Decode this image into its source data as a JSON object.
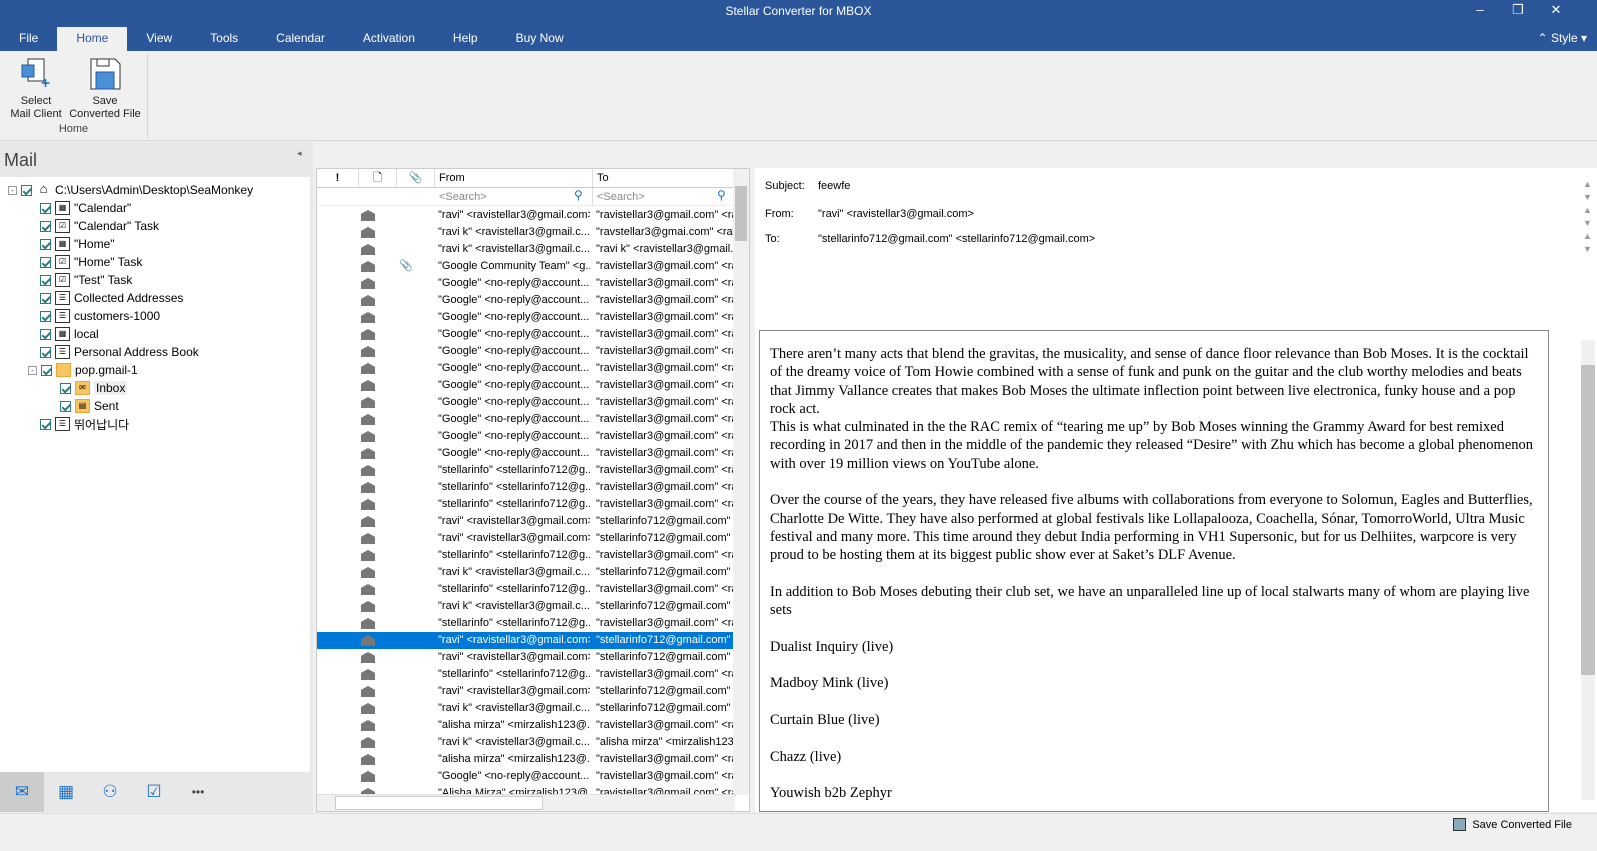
{
  "window": {
    "title": "Stellar Converter for MBOX",
    "minimize": "–",
    "restore": "❐",
    "close": "✕",
    "style_label": "Style"
  },
  "tabs": [
    "File",
    "Home",
    "View",
    "Tools",
    "Calendar",
    "Activation",
    "Help",
    "Buy Now"
  ],
  "ribbon": {
    "select_line1": "Select",
    "select_line2": "Mail Client",
    "save_line1": "Save",
    "save_line2": "Converted File",
    "group": "Home"
  },
  "left": {
    "header": "Mail",
    "tree": [
      {
        "label": "C:\\Users\\Admin\\Desktop\\SeaMonkey",
        "icon": "mailbox-icon",
        "level": 0
      },
      {
        "label": "\"Calendar\"",
        "icon": "calendar-icon",
        "level": 1
      },
      {
        "label": "\"Calendar\" Task",
        "icon": "task-icon",
        "level": 1
      },
      {
        "label": "\"Home\"",
        "icon": "calendar-icon",
        "level": 1
      },
      {
        "label": "\"Home\" Task",
        "icon": "task-icon",
        "level": 1
      },
      {
        "label": "\"Test\" Task",
        "icon": "task-icon",
        "level": 1
      },
      {
        "label": "Collected Addresses",
        "icon": "contacts-icon",
        "level": 1
      },
      {
        "label": "customers-1000",
        "icon": "contacts-icon",
        "level": 1
      },
      {
        "label": "local",
        "icon": "calendar-icon",
        "level": 1
      },
      {
        "label": "Personal Address Book",
        "icon": "contacts-icon",
        "level": 1
      },
      {
        "label": "pop.gmail-1",
        "icon": "folder-icon",
        "level": 1
      },
      {
        "label": "Inbox",
        "icon": "inbox-folder-icon",
        "level": 2
      },
      {
        "label": "Sent",
        "icon": "sent-folder-icon",
        "level": 2
      },
      {
        "label": "뛰어납니다",
        "icon": "contacts-icon",
        "level": 1
      }
    ]
  },
  "nav": [
    "mail-icon",
    "calendar-icon",
    "contacts-icon",
    "tasks-icon",
    "more-icon"
  ],
  "list": {
    "headers": {
      "importance": "!",
      "type": "🗋",
      "attachment": "📎",
      "from": "From",
      "to": "To"
    },
    "search_placeholder": "<Search>",
    "rows": [
      {
        "from": "\"ravi\" <ravistellar3@gmail.com>",
        "to": "\"ravistellar3@gmail.com\" <rav"
      },
      {
        "from": "\"ravi k\" <ravistellar3@gmail.c...",
        "to": "\"ravstellar3@gmai.com\" <ravs"
      },
      {
        "from": "\"ravi k\" <ravistellar3@gmail.c...",
        "to": "\"ravi k\" <ravistellar3@gmail.c"
      },
      {
        "from": "\"Google Community Team\" <g...",
        "to": "\"ravistellar3@gmail.com\" <rav",
        "attach": true
      },
      {
        "from": "\"Google\" <no-reply@account...",
        "to": "\"ravistellar3@gmail.com\" <rav"
      },
      {
        "from": "\"Google\" <no-reply@account...",
        "to": "\"ravistellar3@gmail.com\" <rav"
      },
      {
        "from": "\"Google\" <no-reply@account...",
        "to": "\"ravistellar3@gmail.com\" <rav"
      },
      {
        "from": "\"Google\" <no-reply@account...",
        "to": "\"ravistellar3@gmail.com\" <rav"
      },
      {
        "from": "\"Google\" <no-reply@account...",
        "to": "\"ravistellar3@gmail.com\" <rav"
      },
      {
        "from": "\"Google\" <no-reply@account...",
        "to": "\"ravistellar3@gmail.com\" <rav"
      },
      {
        "from": "\"Google\" <no-reply@account...",
        "to": "\"ravistellar3@gmail.com\" <rav"
      },
      {
        "from": "\"Google\" <no-reply@account...",
        "to": "\"ravistellar3@gmail.com\" <rav"
      },
      {
        "from": "\"Google\" <no-reply@account...",
        "to": "\"ravistellar3@gmail.com\" <rav"
      },
      {
        "from": "\"Google\" <no-reply@account...",
        "to": "\"ravistellar3@gmail.com\" <rav"
      },
      {
        "from": "\"Google\" <no-reply@account...",
        "to": "\"ravistellar3@gmail.com\" <rav"
      },
      {
        "from": "\"stellarinfo\" <stellarinfo712@g...",
        "to": "\"ravistellar3@gmail.com\" <rav"
      },
      {
        "from": "\"stellarinfo\" <stellarinfo712@g...",
        "to": "\"ravistellar3@gmail.com\" <rav"
      },
      {
        "from": "\"stellarinfo\" <stellarinfo712@g...",
        "to": "\"ravistellar3@gmail.com\" <rav"
      },
      {
        "from": "\"ravi\" <ravistellar3@gmail.com>",
        "to": "\"stellarinfo712@gmail.com\" <s"
      },
      {
        "from": "\"ravi\" <ravistellar3@gmail.com>",
        "to": "\"stellarinfo712@gmail.com\" <s"
      },
      {
        "from": "\"stellarinfo\" <stellarinfo712@g...",
        "to": "\"ravistellar3@gmail.com\" <rav"
      },
      {
        "from": "\"ravi k\" <ravistellar3@gmail.c...",
        "to": "\"stellarinfo712@gmail.com\" <s"
      },
      {
        "from": "\"stellarinfo\" <stellarinfo712@g...",
        "to": "\"ravistellar3@gmail.com\" <rav"
      },
      {
        "from": "\"ravi k\" <ravistellar3@gmail.c...",
        "to": "\"stellarinfo712@gmail.com\" <s"
      },
      {
        "from": "\"stellarinfo\" <stellarinfo712@g...",
        "to": "\"ravistellar3@gmail.com\" <rav"
      },
      {
        "from": "\"ravi\" <ravistellar3@gmail.com>",
        "to": "\"stellarinfo712@gmail.com\" <s",
        "selected": true
      },
      {
        "from": "\"ravi\" <ravistellar3@gmail.com>",
        "to": "\"stellarinfo712@gmail.com\" <s"
      },
      {
        "from": "\"stellarinfo\" <stellarinfo712@g...",
        "to": "\"ravistellar3@gmail.com\" <rav"
      },
      {
        "from": "\"ravi\" <ravistellar3@gmail.com>",
        "to": "\"stellarinfo712@gmail.com\" <s"
      },
      {
        "from": "\"ravi k\" <ravistellar3@gmail.c...",
        "to": "\"stellarinfo712@gmail.com\" <s"
      },
      {
        "from": "\"alisha mirza\" <mirzalish123@...",
        "to": "\"ravistellar3@gmail.com\" <rav"
      },
      {
        "from": "\"ravi k\" <ravistellar3@gmail.c...",
        "to": "\"alisha mirza\" <mirzalish123@"
      },
      {
        "from": "\"alisha mirza\" <mirzalish123@...",
        "to": "\"ravistellar3@gmail.com\" <rav"
      },
      {
        "from": "\"Google\" <no-reply@account...",
        "to": "\"ravistellar3@gmail.com\" <rav"
      },
      {
        "from": "\"Alisha Mirza\" <mirzalish123@...",
        "to": "\"ravistellar3@gmail.com\" <rav"
      }
    ]
  },
  "preview": {
    "subject_label": "Subject:",
    "subject": "feewfe",
    "from_label": "From:",
    "from": "\"ravi\" <ravistellar3@gmail.com>",
    "to_label": "To:",
    "to": "\"stellarinfo712@gmail.com\" <stellarinfo712@gmail.com>",
    "body": [
      "There aren’t many acts that blend the gravitas, the musicality, and sense of dance floor relevance than Bob Moses. It is the cocktail of the dreamy voice of Tom Howie combined with a sense of funk and punk on the guitar and the club worthy melodies and beats that Jimmy Vallance creates that makes Bob Moses the ultimate inflection point between live electronica, funky house and a pop rock act.\nThis is what culminated in the the RAC remix of “tearing me up” by Bob Moses winning the Grammy Award for best remixed recording in 2017 and then in the middle of the pandemic they released “Desire” with Zhu which has become a global phenomenon with over 19 million views on YouTube alone.",
      "Over the course of the years, they have released five albums with collaborations from everyone to Solomun, Eagles and Butterflies, Charlotte De Witte. They have also performed at global festivals like Lollapalooza, Coachella, Sónar, TomorroWorld, Ultra Music festival and many more. This time around they debut India performing in VH1 Supersonic, but for us Delhiites, warpcore is very proud to be hosting them at its biggest public show ever at Saket’s DLF Avenue.",
      "In addition to Bob Moses debuting their club set, we have an unparalleled line up of local stalwarts many of whom are playing live sets",
      "Dualist Inquiry (live)",
      "Madboy Mink (live)",
      "Curtain Blue (live)",
      "Chazz (live)",
      "Youwish b2b Zephyr"
    ]
  },
  "status": {
    "save_label": "Save Converted File"
  }
}
